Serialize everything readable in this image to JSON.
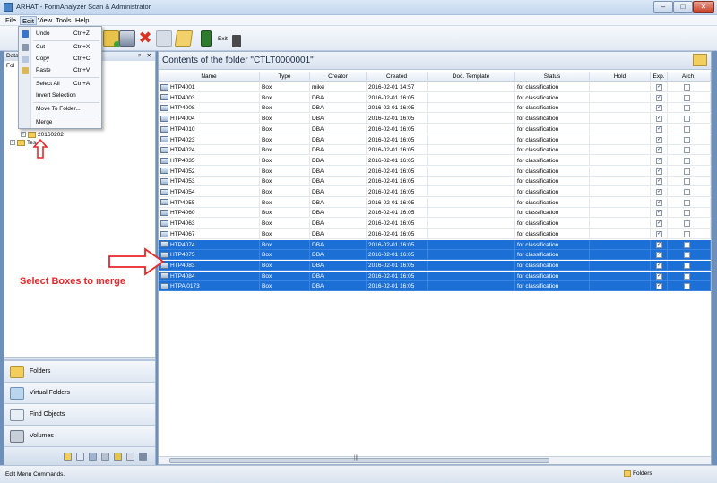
{
  "window": {
    "title": "ARHAT - FormAnalyzer Scan & Administrator",
    "min": "–",
    "max": "□",
    "close": "✕"
  },
  "menu": [
    "File",
    "Edit",
    "View",
    "Tools",
    "Help"
  ],
  "toolbar": {
    "exit_label": "Exit"
  },
  "edit_menu": [
    {
      "label": "Undo",
      "shortcut": "Ctrl+Z"
    },
    {
      "label": "Cut",
      "shortcut": "Ctrl+X"
    },
    {
      "label": "Copy",
      "shortcut": "Ctrl+C"
    },
    {
      "label": "Paste",
      "shortcut": "Ctrl+V"
    },
    {
      "label": "Select All",
      "shortcut": "Ctrl+A"
    },
    {
      "label": "Invert Selection",
      "shortcut": ""
    },
    {
      "label": "Move To Folder...",
      "shortcut": ""
    },
    {
      "label": "Merge",
      "shortcut": ""
    }
  ],
  "left_panel": {
    "header": "Data",
    "pin": "ᵖ",
    "close": "✕",
    "tab": "Fol",
    "tree": [
      {
        "label": "20160202"
      },
      {
        "label": "Tes"
      }
    ],
    "nav": [
      "Folders",
      "Virtual Folders",
      "Find Objects",
      "Volumes"
    ]
  },
  "right_panel": {
    "title": "Contents of the folder \"CTLT0000001\"",
    "columns": [
      "Name",
      "Type",
      "Creator",
      "Created",
      "Doc. Template",
      "Status",
      "Hold",
      "Exp.",
      "Arch."
    ],
    "rows": [
      {
        "name": "HTP4001",
        "type": "Box",
        "creator": "mike",
        "created": "2016-02-01 14:57",
        "status": "for classification",
        "selected": false
      },
      {
        "name": "HTP4003",
        "type": "Box",
        "creator": "DBA",
        "created": "2016-02-01 16:05",
        "status": "for classification",
        "selected": false
      },
      {
        "name": "HTP4008",
        "type": "Box",
        "creator": "DBA",
        "created": "2016-02-01 16:05",
        "status": "for classification",
        "selected": false
      },
      {
        "name": "HTP4004",
        "type": "Box",
        "creator": "DBA",
        "created": "2016-02-01 16:05",
        "status": "for classification",
        "selected": false
      },
      {
        "name": "HTP4010",
        "type": "Box",
        "creator": "DBA",
        "created": "2016-02-01 16:05",
        "status": "for classification",
        "selected": false
      },
      {
        "name": "HTP4023",
        "type": "Box",
        "creator": "DBA",
        "created": "2016-02-01 16:05",
        "status": "for classification",
        "selected": false
      },
      {
        "name": "HTP4024",
        "type": "Box",
        "creator": "DBA",
        "created": "2016-02-01 16:05",
        "status": "for classification",
        "selected": false
      },
      {
        "name": "HTP4035",
        "type": "Box",
        "creator": "DBA",
        "created": "2016-02-01 16:05",
        "status": "for classification",
        "selected": false
      },
      {
        "name": "HTP4052",
        "type": "Box",
        "creator": "DBA",
        "created": "2016-02-01 16:05",
        "status": "for classification",
        "selected": false
      },
      {
        "name": "HTP4053",
        "type": "Box",
        "creator": "DBA",
        "created": "2016-02-01 16:05",
        "status": "for classification",
        "selected": false
      },
      {
        "name": "HTP4054",
        "type": "Box",
        "creator": "DBA",
        "created": "2016-02-01 16:05",
        "status": "for classification",
        "selected": false
      },
      {
        "name": "HTP4055",
        "type": "Box",
        "creator": "DBA",
        "created": "2016-02-01 16:05",
        "status": "for classification",
        "selected": false
      },
      {
        "name": "HTP4060",
        "type": "Box",
        "creator": "DBA",
        "created": "2016-02-01 16:05",
        "status": "for classification",
        "selected": false
      },
      {
        "name": "HTP4063",
        "type": "Box",
        "creator": "DBA",
        "created": "2016-02-01 16:05",
        "status": "for classification",
        "selected": false
      },
      {
        "name": "HTP4067",
        "type": "Box",
        "creator": "DBA",
        "created": "2016-02-01 16:05",
        "status": "for classification",
        "selected": false
      },
      {
        "name": "HTP4074",
        "type": "Box",
        "creator": "DBA",
        "created": "2016-02-01 16:05",
        "status": "for classification",
        "selected": true
      },
      {
        "name": "HTP4075",
        "type": "Box",
        "creator": "DBA",
        "created": "2016-02-01 16:05",
        "status": "for classification",
        "selected": true
      },
      {
        "name": "HTP4083",
        "type": "Box",
        "creator": "DBA",
        "created": "2016-02-01 16:05",
        "status": "for classification",
        "selected": true
      },
      {
        "name": "HTP4084",
        "type": "Box",
        "creator": "DBA",
        "created": "2016-02-01 16:05",
        "status": "for classification",
        "selected": true
      },
      {
        "name": "HTPA 0173",
        "type": "Box",
        "creator": "DBA",
        "created": "2016-02-01 16:05",
        "status": "for classification",
        "selected": true
      }
    ],
    "exp_check": "✓",
    "scroll_grip": "|||"
  },
  "annotation": "Select Boxes to merge",
  "statusbar": {
    "text": "Edit Menu Commands.",
    "right": "Folders"
  },
  "colors": {
    "selection": "#1c6fd4",
    "annotation": "#e8272a"
  }
}
